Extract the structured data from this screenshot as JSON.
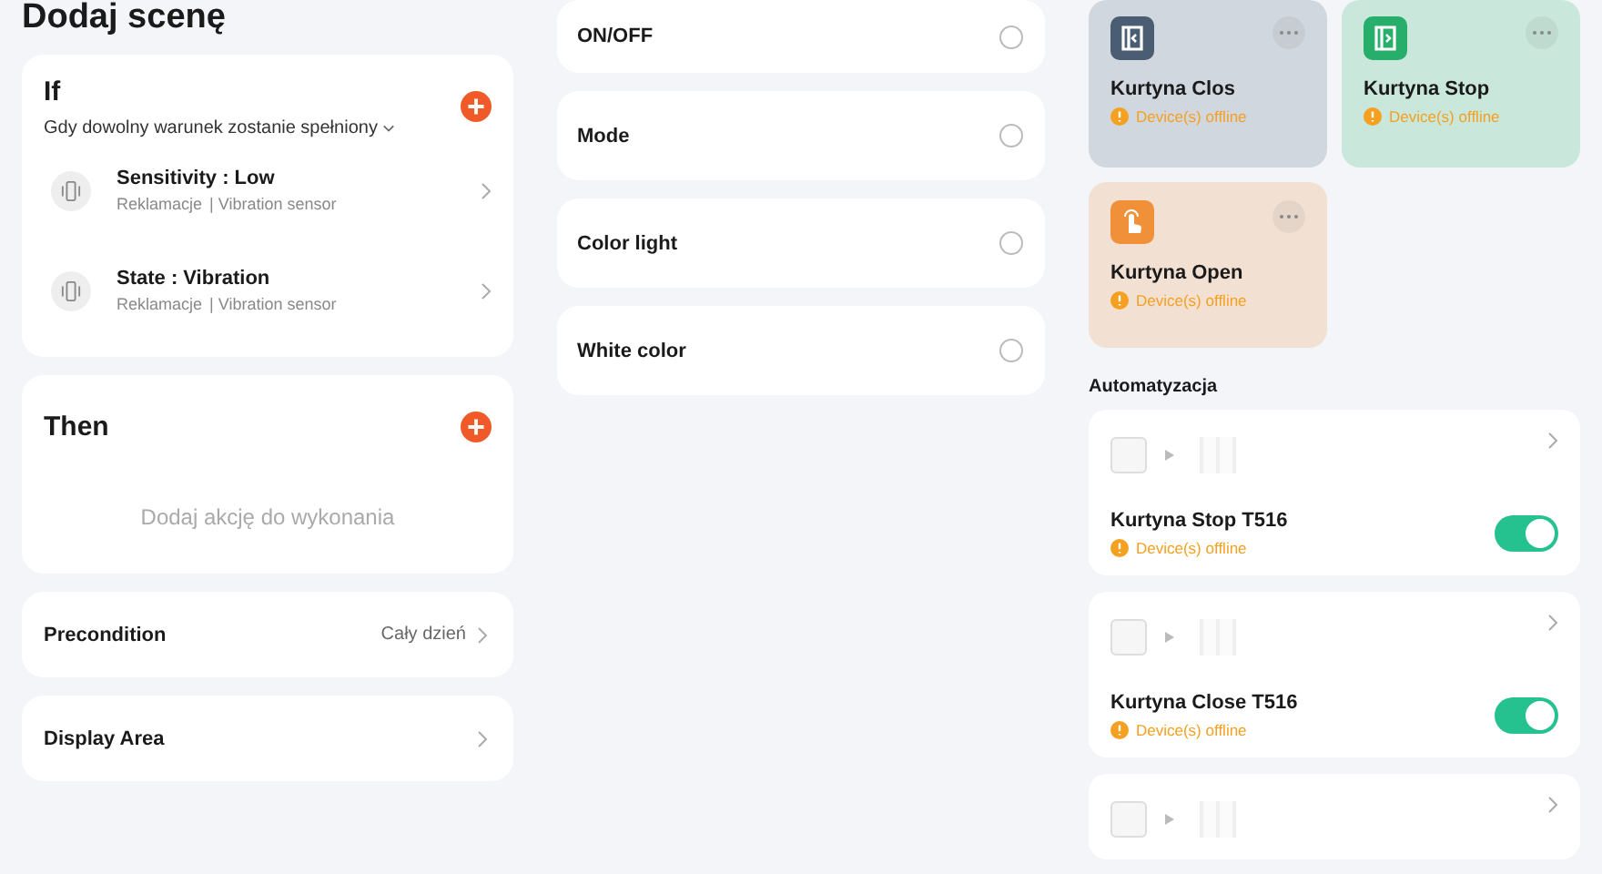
{
  "title": "Dodaj scenę",
  "if_card": {
    "title": "If",
    "condition_mode": "Gdy dowolny warunek zostanie spełniony",
    "conditions": [
      {
        "name": "Sensitivity : Low",
        "room": "Reklamacje",
        "device": "| Vibration sensor"
      },
      {
        "name": "State : Vibration",
        "room": "Reklamacje",
        "device": "| Vibration sensor"
      }
    ]
  },
  "then_card": {
    "title": "Then",
    "empty_text": "Dodaj akcję do wykonania"
  },
  "settings": [
    {
      "label": "Precondition",
      "value": "Cały dzień"
    },
    {
      "label": "Display Area"
    }
  ],
  "functions": [
    {
      "label": "ON/OFF",
      "selected": false
    },
    {
      "label": "Mode",
      "selected": false
    },
    {
      "label": "Color light",
      "selected": false
    },
    {
      "label": "White color",
      "selected": false
    }
  ],
  "scenes": [
    {
      "name": "Kurtyna Clos",
      "status": "Device(s) offline",
      "color": "#4a5d73",
      "kind": "close"
    },
    {
      "name": "Kurtyna Stop",
      "status": "Device(s) offline",
      "color": "#27ae6a",
      "kind": "stop"
    },
    {
      "name": "Kurtyna Open",
      "status": "Device(s) offline",
      "color": "#f0913a",
      "kind": "tap"
    }
  ],
  "automation_heading": "Automatyzacja",
  "automations": [
    {
      "kind": "full",
      "name": "Kurtyna Stop T516",
      "status": "Device(s) offline",
      "on": true
    },
    {
      "kind": "full",
      "name": "Kurtyna Close T516",
      "status": "Device(s) offline",
      "on": true
    },
    {
      "kind": "cut"
    }
  ]
}
